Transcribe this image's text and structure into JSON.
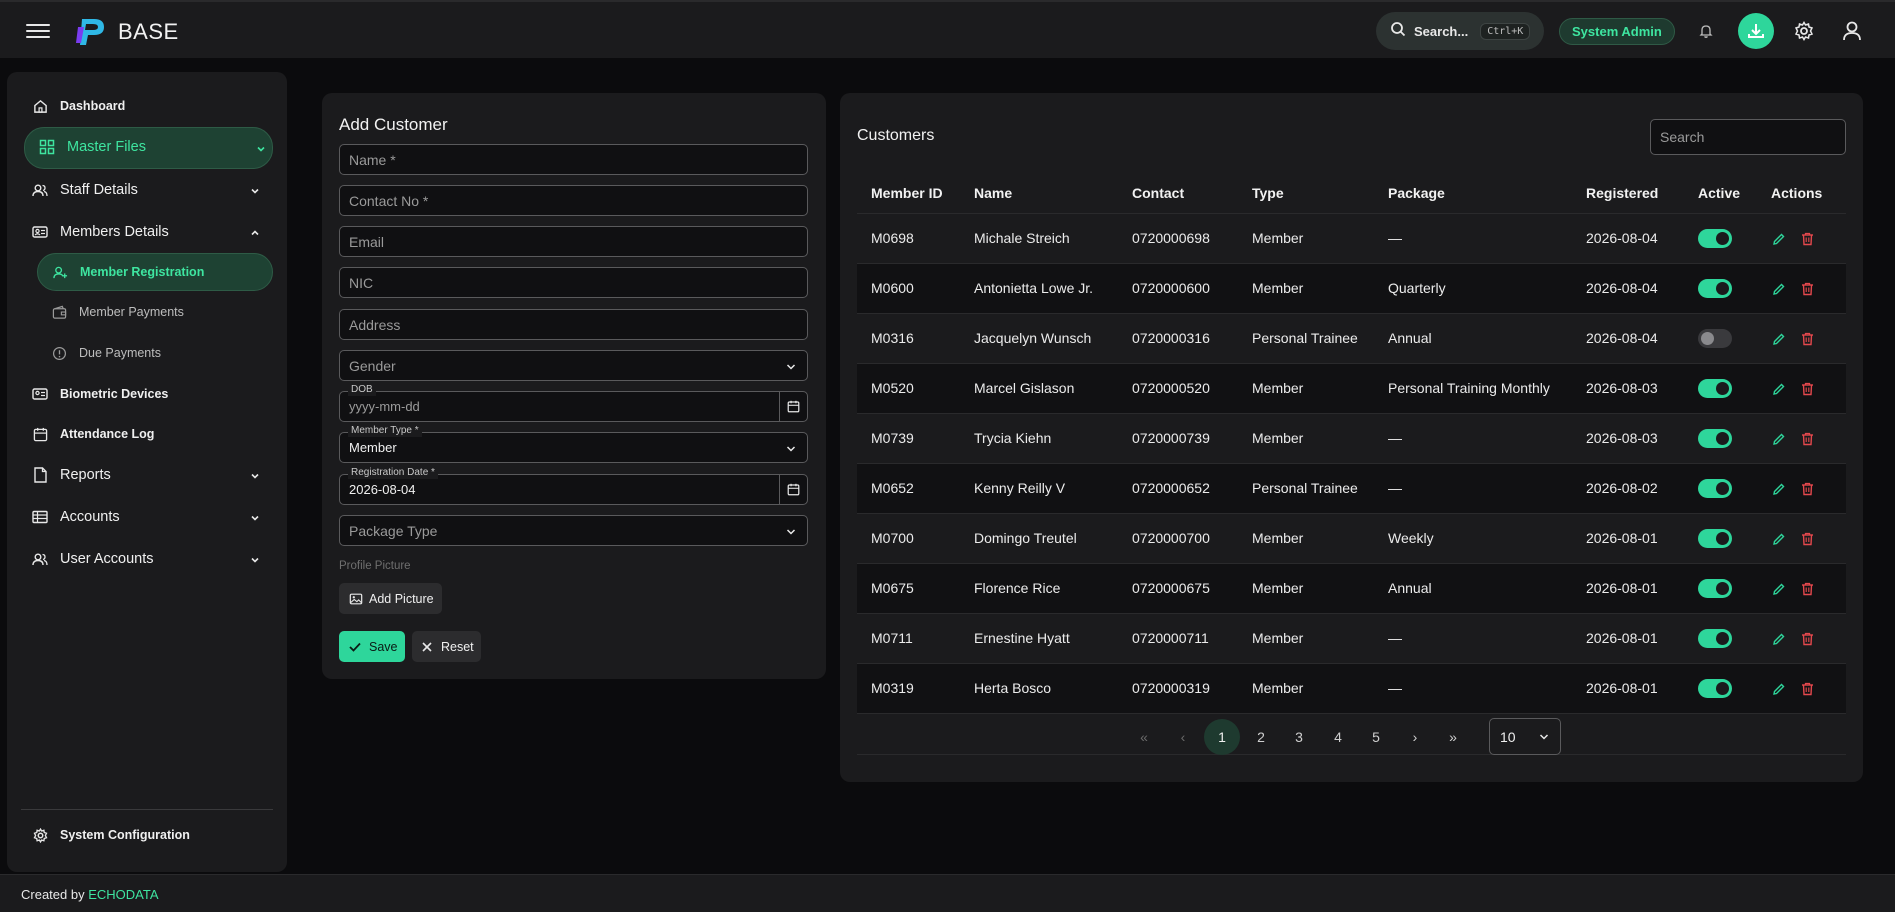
{
  "header": {
    "brand": "BASE",
    "search_label": "Search...",
    "search_shortcut": "Ctrl+K",
    "role": "System Admin"
  },
  "sidebar": {
    "dashboard": "Dashboard",
    "master_files": "Master Files",
    "staff_details": "Staff Details",
    "members_details": "Members Details",
    "member_registration": "Member Registration",
    "member_payments": "Member Payments",
    "due_payments": "Due Payments",
    "biometric_devices": "Biometric Devices",
    "attendance_log": "Attendance Log",
    "reports": "Reports",
    "accounts": "Accounts",
    "user_accounts": "User Accounts",
    "system_configuration": "System Configuration"
  },
  "form": {
    "title": "Add Customer",
    "name_placeholder": "Name *",
    "contact_placeholder": "Contact No *",
    "email_placeholder": "Email",
    "nic_placeholder": "NIC",
    "address_placeholder": "Address",
    "gender_placeholder": "Gender",
    "dob_label": "DOB",
    "dob_placeholder": "yyyy-mm-dd",
    "member_type_label": "Member Type *",
    "member_type_value": "Member",
    "reg_date_label": "Registration Date *",
    "reg_date_value": "2026-08-04",
    "package_placeholder": "Package Type",
    "profile_picture_label": "Profile Picture",
    "add_picture": "Add Picture",
    "save": "Save",
    "reset": "Reset"
  },
  "customers": {
    "title": "Customers",
    "search_placeholder": "Search",
    "columns": [
      "Member ID",
      "Name",
      "Contact",
      "Type",
      "Package",
      "Registered",
      "Active",
      "Actions"
    ],
    "rows": [
      {
        "id": "M0698",
        "name": "Michale Streich",
        "contact": "0720000698",
        "type": "Member",
        "package": "—",
        "registered": "2026-08-04",
        "active": true
      },
      {
        "id": "M0600",
        "name": "Antonietta Lowe Jr.",
        "contact": "0720000600",
        "type": "Member",
        "package": "Quarterly",
        "registered": "2026-08-04",
        "active": true
      },
      {
        "id": "M0316",
        "name": "Jacquelyn Wunsch",
        "contact": "0720000316",
        "type": "Personal Trainee",
        "package": "Annual",
        "registered": "2026-08-04",
        "active": false
      },
      {
        "id": "M0520",
        "name": "Marcel Gislason",
        "contact": "0720000520",
        "type": "Member",
        "package": "Personal Training Monthly",
        "registered": "2026-08-03",
        "active": true
      },
      {
        "id": "M0739",
        "name": "Trycia Kiehn",
        "contact": "0720000739",
        "type": "Member",
        "package": "—",
        "registered": "2026-08-03",
        "active": true
      },
      {
        "id": "M0652",
        "name": "Kenny Reilly V",
        "contact": "0720000652",
        "type": "Personal Trainee",
        "package": "—",
        "registered": "2026-08-02",
        "active": true
      },
      {
        "id": "M0700",
        "name": "Domingo Treutel",
        "contact": "0720000700",
        "type": "Member",
        "package": "Weekly",
        "registered": "2026-08-01",
        "active": true
      },
      {
        "id": "M0675",
        "name": "Florence Rice",
        "contact": "0720000675",
        "type": "Member",
        "package": "Annual",
        "registered": "2026-08-01",
        "active": true
      },
      {
        "id": "M0711",
        "name": "Ernestine Hyatt",
        "contact": "0720000711",
        "type": "Member",
        "package": "—",
        "registered": "2026-08-01",
        "active": true
      },
      {
        "id": "M0319",
        "name": "Herta Bosco",
        "contact": "0720000319",
        "type": "Member",
        "package": "—",
        "registered": "2026-08-01",
        "active": true
      }
    ],
    "pagination": {
      "first": "«",
      "prev": "‹",
      "pages": [
        "1",
        "2",
        "3",
        "4",
        "5"
      ],
      "current": "1",
      "next": "›",
      "last": "»",
      "per_page": "10"
    }
  },
  "footer": {
    "created_by": "Created by",
    "company": "ECHODATA"
  },
  "colors": {
    "accent": "#2ed69b",
    "danger": "#e5484d",
    "background": "#0b0b0d",
    "surface": "#1b1b1d"
  }
}
